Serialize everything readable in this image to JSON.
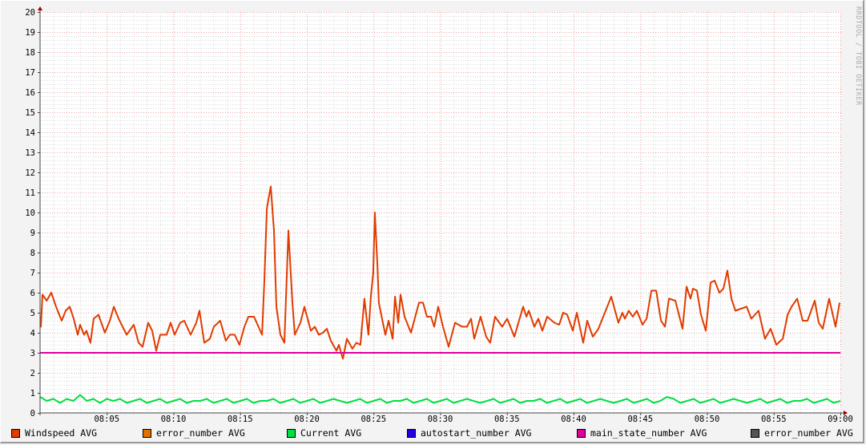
{
  "watermark": "RRDTOOL / TOBI OETIKER",
  "chart_data": {
    "type": "line",
    "title": "",
    "xlabel": "",
    "ylabel": "",
    "xlim_minutes": [
      0,
      60
    ],
    "ylim": [
      0,
      20
    ],
    "y_ticks": [
      "0",
      "1",
      "2",
      "3",
      "4",
      "5",
      "6",
      "7",
      "8",
      "9",
      "10",
      "11",
      "12",
      "13",
      "14",
      "15",
      "16",
      "17",
      "18",
      "19",
      "20"
    ],
    "x_ticks": [
      {
        "minute": 5,
        "label": "08:05"
      },
      {
        "minute": 10,
        "label": "08:10"
      },
      {
        "minute": 15,
        "label": "08:15"
      },
      {
        "minute": 20,
        "label": "08:20"
      },
      {
        "minute": 25,
        "label": "08:25"
      },
      {
        "minute": 30,
        "label": "08:30"
      },
      {
        "minute": 35,
        "label": "08:35"
      },
      {
        "minute": 40,
        "label": "08:40"
      },
      {
        "minute": 45,
        "label": "08:45"
      },
      {
        "minute": 50,
        "label": "08:50"
      },
      {
        "minute": 55,
        "label": "08:55"
      },
      {
        "minute": 60,
        "label": "09:00"
      }
    ],
    "grid": true,
    "legend_position": "bottom",
    "legend": [
      {
        "name": "Windspeed AVG",
        "color": "#e03c00"
      },
      {
        "name": "error_number AVG",
        "color": "#e07000"
      },
      {
        "name": "Current AVG",
        "color": "#00e040"
      },
      {
        "name": "autostart_number AVG",
        "color": "#2000e0"
      },
      {
        "name": "main_state_number AVG",
        "color": "#e000a0"
      },
      {
        "name": "error_number AVG",
        "color": "#555555"
      }
    ],
    "series": [
      {
        "name": "Windspeed AVG",
        "color": "#e03c00",
        "minutes": [
          0,
          0.06,
          0.18,
          0.5,
          0.84,
          1.2,
          1.62,
          1.92,
          2.22,
          2.52,
          2.82,
          3.0,
          3.3,
          3.48,
          3.78,
          4.02,
          4.38,
          4.86,
          5.23,
          5.53,
          5.89,
          6.49,
          7.03,
          7.39,
          7.69,
          8.11,
          8.41,
          8.71,
          9.01,
          9.49,
          9.79,
          10.09,
          10.51,
          10.81,
          11.29,
          11.71,
          11.95,
          12.31,
          12.73,
          13.03,
          13.51,
          13.93,
          14.23,
          14.59,
          14.95,
          15.32,
          15.62,
          16.04,
          16.64,
          16.82,
          17.0,
          17.3,
          17.54,
          17.72,
          18.02,
          18.32,
          18.62,
          18.92,
          19.1,
          19.52,
          19.82,
          20.3,
          20.6,
          20.9,
          21.2,
          21.5,
          21.8,
          22.22,
          22.4,
          22.7,
          23.0,
          23.42,
          23.72,
          24.02,
          24.32,
          24.62,
          24.8,
          24.98,
          25.1,
          25.29,
          25.4,
          25.7,
          25.89,
          26.13,
          26.43,
          26.61,
          26.85,
          27.03,
          27.33,
          27.81,
          28.41,
          28.71,
          29.01,
          29.31,
          29.55,
          29.85,
          30.21,
          30.63,
          31.11,
          31.65,
          32.01,
          32.31,
          32.55,
          33.03,
          33.45,
          33.75,
          34.11,
          34.65,
          35.02,
          35.56,
          35.86,
          36.22,
          36.46,
          36.64,
          37.06,
          37.36,
          37.66,
          38.02,
          38.56,
          38.92,
          39.22,
          39.52,
          39.94,
          40.24,
          40.72,
          41.02,
          41.44,
          41.86,
          42.22,
          42.82,
          43.36,
          43.66,
          43.84,
          44.14,
          44.44,
          44.74,
          45.17,
          45.47,
          45.83,
          46.19,
          46.55,
          46.85,
          47.15,
          47.63,
          48.17,
          48.47,
          48.77,
          48.95,
          49.25,
          49.55,
          49.91,
          50.27,
          50.57,
          50.93,
          51.23,
          51.53,
          51.83,
          52.13,
          52.55,
          52.97,
          53.33,
          53.87,
          54.35,
          54.77,
          55.2,
          55.68,
          56.04,
          56.34,
          56.76,
          57.18,
          57.54,
          58.08,
          58.38,
          58.68,
          59.16,
          59.64,
          59.94
        ],
        "values": [
          4.3,
          4.3,
          5.9,
          5.6,
          6.0,
          5.3,
          4.6,
          5.1,
          5.3,
          4.7,
          3.9,
          4.4,
          3.9,
          4.1,
          3.5,
          4.7,
          4.9,
          4.0,
          4.6,
          5.3,
          4.7,
          3.9,
          4.4,
          3.5,
          3.3,
          4.5,
          4.1,
          3.1,
          3.9,
          3.9,
          4.5,
          3.9,
          4.5,
          4.6,
          3.9,
          4.5,
          5.1,
          3.5,
          3.7,
          4.3,
          4.6,
          3.6,
          3.9,
          3.9,
          3.4,
          4.3,
          4.8,
          4.8,
          3.9,
          6.7,
          10.2,
          11.3,
          9.1,
          5.3,
          3.9,
          3.5,
          9.1,
          5.5,
          3.9,
          4.5,
          5.3,
          4.1,
          4.3,
          3.9,
          4.0,
          4.2,
          3.6,
          3.1,
          3.4,
          2.7,
          3.7,
          3.2,
          3.5,
          3.4,
          5.7,
          3.9,
          5.8,
          7.0,
          10.0,
          7.4,
          5.5,
          4.5,
          3.9,
          4.6,
          3.7,
          5.8,
          4.5,
          5.9,
          4.8,
          4.0,
          5.5,
          5.5,
          4.8,
          4.8,
          4.3,
          5.3,
          4.3,
          3.3,
          4.5,
          4.3,
          4.3,
          4.7,
          3.7,
          4.8,
          3.8,
          3.5,
          4.8,
          4.3,
          4.7,
          3.8,
          4.5,
          5.3,
          4.8,
          5.1,
          4.3,
          4.7,
          4.1,
          4.8,
          4.5,
          4.4,
          5.0,
          4.9,
          4.1,
          5.0,
          3.5,
          4.6,
          3.8,
          4.2,
          4.8,
          5.8,
          4.5,
          5.0,
          4.7,
          5.1,
          4.8,
          5.1,
          4.4,
          4.7,
          6.1,
          6.1,
          4.6,
          4.3,
          5.7,
          5.6,
          4.2,
          6.3,
          5.7,
          6.2,
          6.1,
          4.9,
          4.1,
          6.5,
          6.6,
          6.0,
          6.2,
          7.1,
          5.7,
          5.1,
          5.2,
          5.3,
          4.7,
          5.1,
          3.7,
          4.2,
          3.4,
          3.7,
          4.9,
          5.3,
          5.7,
          4.6,
          4.6,
          5.6,
          4.5,
          4.2,
          5.7,
          4.3,
          5.5
        ]
      },
      {
        "name": "Current AVG",
        "color": "#00e040",
        "minutes_step": 0.5,
        "values": [
          0.8,
          0.6,
          0.7,
          0.5,
          0.7,
          0.6,
          0.9,
          0.6,
          0.7,
          0.5,
          0.7,
          0.6,
          0.7,
          0.5,
          0.6,
          0.7,
          0.5,
          0.6,
          0.7,
          0.5,
          0.6,
          0.7,
          0.5,
          0.6,
          0.6,
          0.7,
          0.5,
          0.6,
          0.7,
          0.5,
          0.6,
          0.7,
          0.5,
          0.6,
          0.6,
          0.7,
          0.5,
          0.6,
          0.7,
          0.5,
          0.6,
          0.7,
          0.5,
          0.6,
          0.7,
          0.6,
          0.5,
          0.6,
          0.7,
          0.5,
          0.6,
          0.7,
          0.5,
          0.6,
          0.6,
          0.7,
          0.5,
          0.6,
          0.7,
          0.5,
          0.6,
          0.7,
          0.5,
          0.6,
          0.7,
          0.6,
          0.5,
          0.6,
          0.7,
          0.5,
          0.6,
          0.7,
          0.5,
          0.6,
          0.6,
          0.7,
          0.5,
          0.6,
          0.7,
          0.5,
          0.6,
          0.7,
          0.5,
          0.6,
          0.7,
          0.6,
          0.5,
          0.6,
          0.7,
          0.5,
          0.6,
          0.7,
          0.5,
          0.6,
          0.8,
          0.7,
          0.5,
          0.6,
          0.7,
          0.5,
          0.6,
          0.7,
          0.5,
          0.6,
          0.7,
          0.6,
          0.5,
          0.6,
          0.7,
          0.5,
          0.6,
          0.7,
          0.5,
          0.6,
          0.6,
          0.7,
          0.5,
          0.6,
          0.7,
          0.5,
          0.6
        ]
      },
      {
        "name": "main_state_number AVG",
        "color": "#e000a0",
        "constant": 3
      }
    ]
  }
}
